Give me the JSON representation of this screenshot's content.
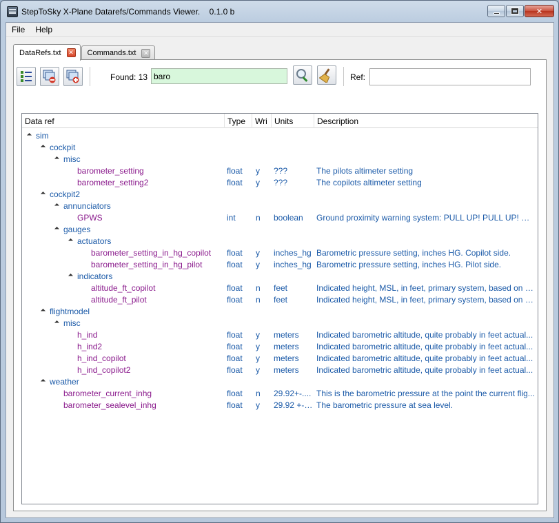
{
  "window": {
    "title": "StepToSky X-Plane Datarefs/Commands Viewer.    0.1.0 b"
  },
  "menu": [
    "File",
    "Help"
  ],
  "tabs": [
    {
      "label": "DataRefs.txt",
      "active": true
    },
    {
      "label": "Commands.txt",
      "active": false
    }
  ],
  "toolbar": {
    "found_label": "Found: 13",
    "search_value": "baro",
    "ref_label": "Ref:",
    "ref_value": ""
  },
  "columns": [
    "Data ref",
    "Type",
    "Wri",
    "Units",
    "Description"
  ],
  "rows": [
    {
      "level": 0,
      "folder": true,
      "name": "sim"
    },
    {
      "level": 1,
      "folder": true,
      "name": "cockpit"
    },
    {
      "level": 2,
      "folder": true,
      "name": "misc"
    },
    {
      "level": 3,
      "folder": false,
      "name": "barometer_setting",
      "type": "float",
      "writable": "y",
      "units": "???",
      "desc": "The pilots altimeter setting"
    },
    {
      "level": 3,
      "folder": false,
      "name": "barometer_setting2",
      "type": "float",
      "writable": "y",
      "units": "???",
      "desc": "The copilots altimeter setting"
    },
    {
      "level": 1,
      "folder": true,
      "name": "cockpit2"
    },
    {
      "level": 2,
      "folder": true,
      "name": "annunciators"
    },
    {
      "level": 3,
      "folder": false,
      "name": "GPWS",
      "type": "int",
      "writable": "n",
      "units": "boolean",
      "desc": "Ground proximity warning system: PULL UP! PULL UP! my ..."
    },
    {
      "level": 2,
      "folder": true,
      "name": "gauges"
    },
    {
      "level": 3,
      "folder": true,
      "name": "actuators"
    },
    {
      "level": 4,
      "folder": false,
      "name": "barometer_setting_in_hg_copilot",
      "type": "float",
      "writable": "y",
      "units": "inches_hg",
      "desc": "Barometric pressure setting, inches HG.  Copilot side."
    },
    {
      "level": 4,
      "folder": false,
      "name": "barometer_setting_in_hg_pilot",
      "type": "float",
      "writable": "y",
      "units": "inches_hg",
      "desc": "Barometric pressure setting, inches HG.  Pilot side."
    },
    {
      "level": 3,
      "folder": true,
      "name": "indicators"
    },
    {
      "level": 4,
      "folder": false,
      "name": "altitude_ft_copilot",
      "type": "float",
      "writable": "n",
      "units": "feet",
      "desc": "Indicated height, MSL, in feet, primary system, based on c..."
    },
    {
      "level": 4,
      "folder": false,
      "name": "altitude_ft_pilot",
      "type": "float",
      "writable": "n",
      "units": "feet",
      "desc": "Indicated height, MSL, in feet, primary system, based on p..."
    },
    {
      "level": 1,
      "folder": true,
      "name": "flightmodel"
    },
    {
      "level": 2,
      "folder": true,
      "name": "misc"
    },
    {
      "level": 3,
      "folder": false,
      "name": "h_ind",
      "type": "float",
      "writable": "y",
      "units": "meters",
      "desc": "Indicated barometric altitude, quite probably in feet actual..."
    },
    {
      "level": 3,
      "folder": false,
      "name": "h_ind2",
      "type": "float",
      "writable": "y",
      "units": "meters",
      "desc": "Indicated barometric altitude, quite probably in feet actual..."
    },
    {
      "level": 3,
      "folder": false,
      "name": "h_ind_copilot",
      "type": "float",
      "writable": "y",
      "units": "meters",
      "desc": "Indicated barometric altitude, quite probably in feet actual..."
    },
    {
      "level": 3,
      "folder": false,
      "name": "h_ind_copilot2",
      "type": "float",
      "writable": "y",
      "units": "meters",
      "desc": "Indicated barometric altitude, quite probably in feet actual..."
    },
    {
      "level": 1,
      "folder": true,
      "name": "weather"
    },
    {
      "level": 2,
      "folder": false,
      "name": "barometer_current_inhg",
      "type": "float",
      "writable": "n",
      "units": "29.92+-....",
      "desc": "This is the barometric pressure at the point the current flig..."
    },
    {
      "level": 2,
      "folder": false,
      "name": "barometer_sealevel_inhg",
      "type": "float",
      "writable": "y",
      "units": "29.92 +- ....",
      "desc": "The barometric pressure at sea level."
    }
  ]
}
